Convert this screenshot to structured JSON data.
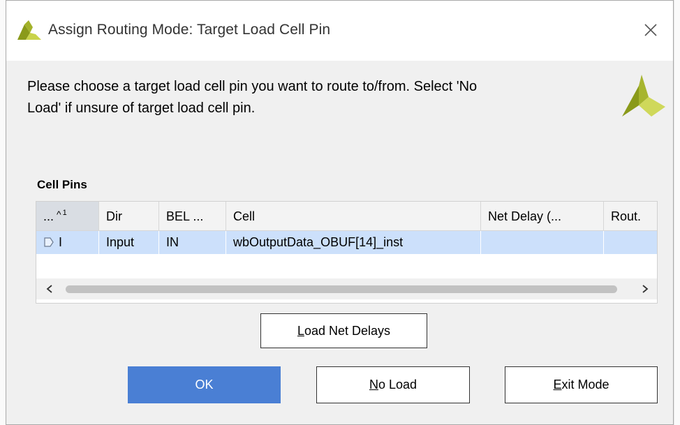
{
  "dialog": {
    "title": "Assign Routing Mode: Target Load Cell Pin",
    "close_icon": "close-icon",
    "message_line1": "Please choose a target load cell pin you want to route to/from. Select 'No",
    "message_line2": "Load' if unsure of target load cell pin.",
    "section_label": "Cell Pins"
  },
  "table": {
    "columns": [
      {
        "label": "...",
        "sort_indicator": "^",
        "sort_order": "1"
      },
      {
        "label": "Dir"
      },
      {
        "label": "BEL ..."
      },
      {
        "label": "Cell"
      },
      {
        "label": "Net Delay (..."
      },
      {
        "label": "Rout."
      }
    ],
    "rows": [
      {
        "pin": "I",
        "dir": "Input",
        "bel": "IN",
        "cell": "wbOutputData_OBUF[14]_inst",
        "net_delay": "",
        "rout": ""
      }
    ]
  },
  "buttons": {
    "load_net_delays": {
      "mnemonic": "L",
      "rest": "oad Net Delays"
    },
    "ok": "OK",
    "no_load": {
      "mnemonic": "N",
      "rest": "o Load"
    },
    "exit_mode": {
      "mnemonic": "E",
      "rest": "xit Mode"
    }
  },
  "colors": {
    "logo_dark": "#8a9a1a",
    "logo_light": "#c9d34a",
    "selected_row": "#cce0fb",
    "primary_button": "#4a7fd4"
  }
}
